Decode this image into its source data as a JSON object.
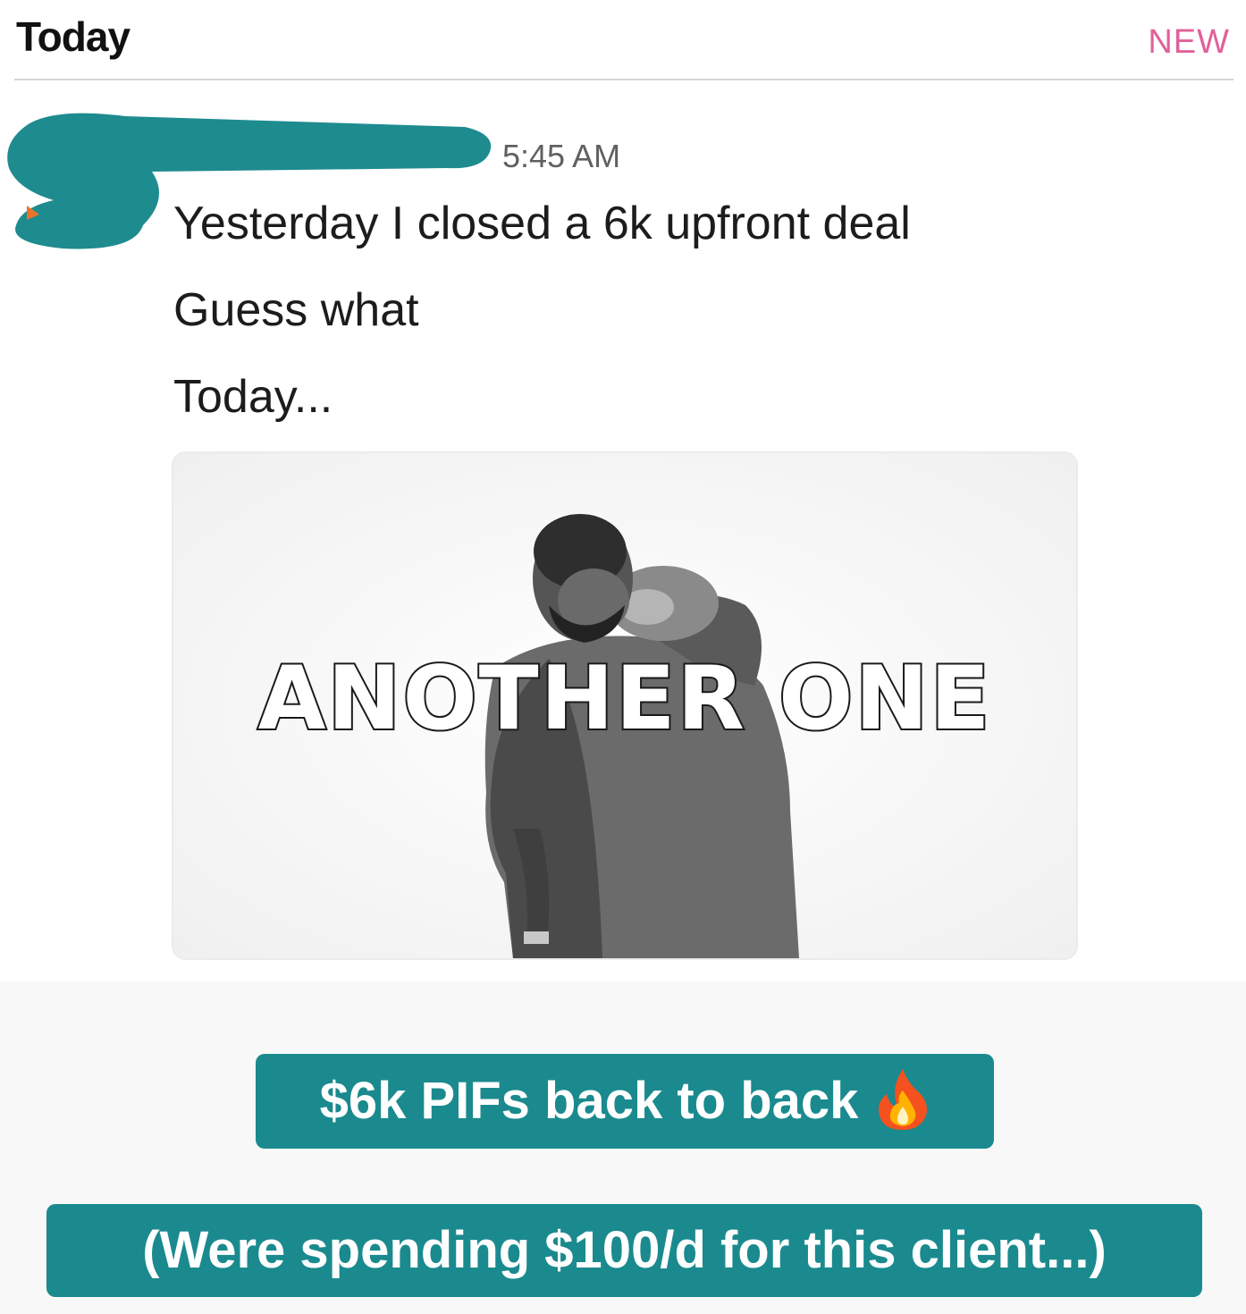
{
  "header": {
    "section_label": "Today",
    "new_badge": "NEW"
  },
  "message": {
    "timestamp": "5:45 AM",
    "lines": [
      "Yesterday I closed a 6k upfront deal",
      "Guess what",
      "Today..."
    ],
    "gif": {
      "caption": "ANOTHER ONE"
    }
  },
  "overlay": {
    "banner_1": "$6k PIFs back to back",
    "banner_1_icon": "fire-icon",
    "banner_2": "(Were spending $100/d for this client...)"
  },
  "colors": {
    "accent_teal": "#1a8a8e",
    "new_badge": "#e0619a",
    "redaction": "#1e8b8f"
  }
}
